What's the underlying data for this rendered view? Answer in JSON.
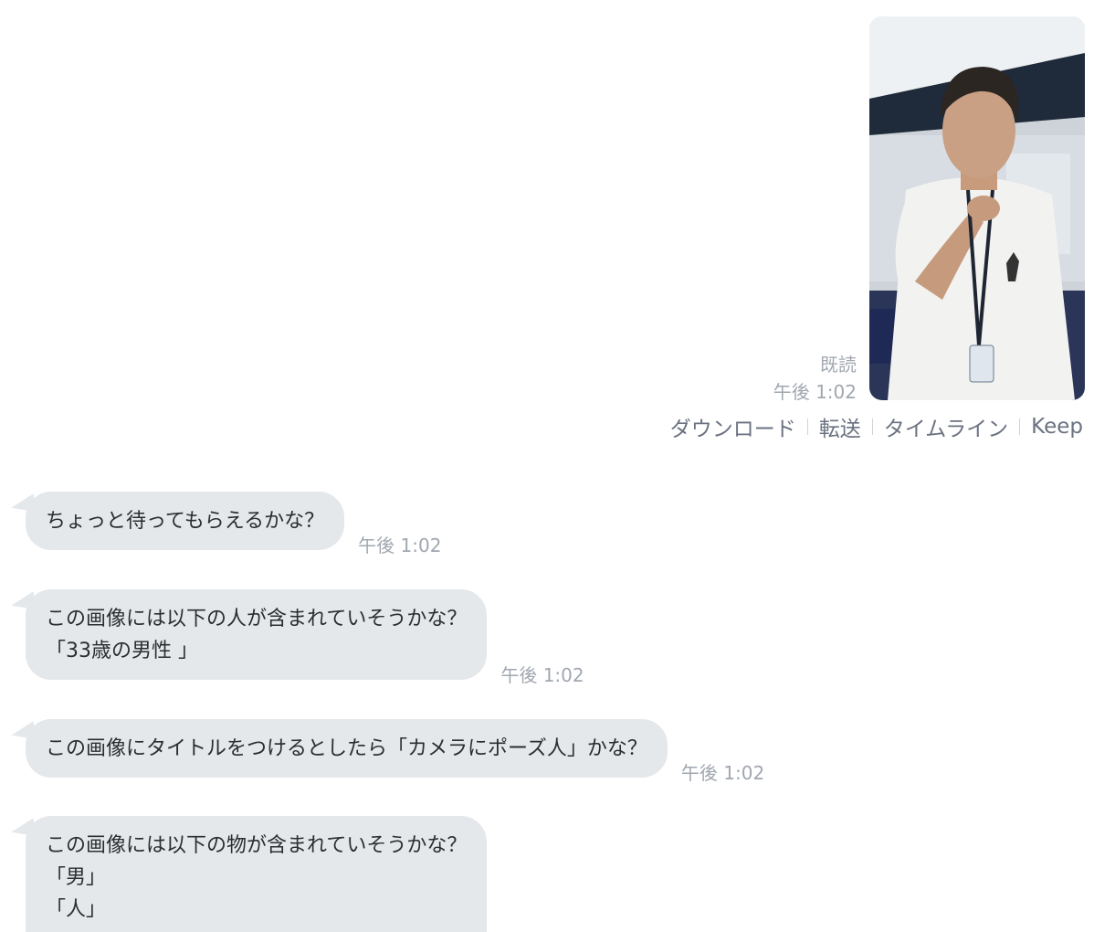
{
  "sent": {
    "read_label": "既読",
    "time": "午後 1:02",
    "photo_icon": "photo-image",
    "actions": {
      "download": "ダウンロード",
      "forward": "転送",
      "timeline": "タイムライン",
      "keep": "Keep"
    }
  },
  "messages": [
    {
      "lines": [
        "ちょっと待ってもらえるかな？"
      ],
      "time": "午後 1:02"
    },
    {
      "lines": [
        "この画像には以下の人が含まれていそうかな？",
        "「33歳の男性 」"
      ],
      "time": "午後 1:02"
    },
    {
      "lines": [
        "この画像にタイトルをつけるとしたら「カメラにポーズ人」かな？"
      ],
      "time": "午後 1:02"
    },
    {
      "lines": [
        "この画像には以下の物が含まれていそうかな？",
        "「男」",
        "「人」"
      ],
      "time": ""
    }
  ],
  "colors": {
    "bubble_bg": "#e5e8eb",
    "meta_text": "#a1a7b0",
    "action_text": "#6b7280"
  }
}
